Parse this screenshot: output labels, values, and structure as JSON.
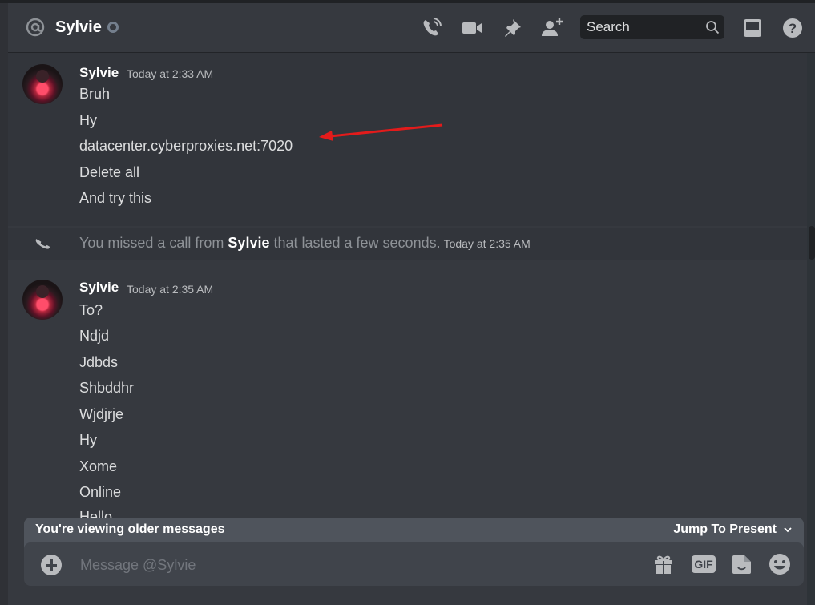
{
  "header": {
    "channel_name": "Sylvie",
    "search_placeholder": "Search",
    "icons": [
      "at-icon",
      "status-offline-icon",
      "voice-call-icon",
      "video-call-icon",
      "pin-icon",
      "add-friend-icon",
      "search-icon",
      "inbox-icon",
      "help-icon"
    ]
  },
  "messages": [
    {
      "author": "Sylvie",
      "timestamp": "Today at 2:33 AM",
      "lines": [
        "Bruh",
        "Hy",
        "datacenter.cyberproxies.net:7020",
        "Delete all",
        "And try this"
      ]
    },
    {
      "type": "call",
      "prefix": "You missed a call from ",
      "author": "Sylvie",
      "suffix": " that lasted a few seconds.",
      "timestamp": "Today at 2:35 AM"
    },
    {
      "author": "Sylvie",
      "timestamp": "Today at 2:35 AM",
      "lines": [
        "To?",
        "Ndjd",
        "Jdbds",
        "Shbddhr",
        "Wjdjrje",
        "Hy",
        "Xome",
        "Online",
        "Hello"
      ]
    }
  ],
  "annotation": {
    "type": "red-arrow",
    "color": "#e31b1b",
    "points_to": "datacenter.cyberproxies.net:7020"
  },
  "older_bar": {
    "text": "You're viewing older messages",
    "jump_label": "Jump To Present"
  },
  "composer": {
    "placeholder": "Message @Sylvie",
    "gif_label": "GIF",
    "icons": [
      "add-attachment-icon",
      "gift-icon",
      "gif-icon",
      "sticker-icon",
      "emoji-icon"
    ]
  },
  "colors": {
    "background": "#36393f",
    "header_text": "#ffffff",
    "message_text": "#dcddde",
    "muted_text": "#8e9297",
    "input_bg": "#40444b",
    "banner_bg": "#4f545c"
  }
}
